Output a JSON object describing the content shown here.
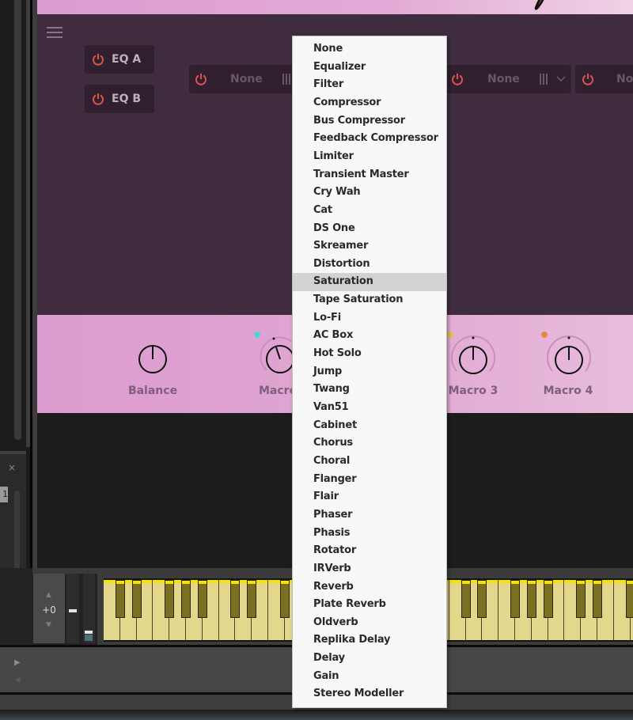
{
  "side_panel": {
    "close_symbol": "×",
    "tag_label": "1"
  },
  "plugin": {
    "menu_icon": "hamburger-icon",
    "eq_buttons": [
      {
        "label": "EQ A",
        "power_on": true
      },
      {
        "label": "EQ B",
        "power_on": true
      }
    ],
    "effect_slots": [
      {
        "label": "None",
        "power_on": true
      },
      {
        "label": "None",
        "power_on": true
      },
      {
        "label": "No",
        "power_on": true
      }
    ],
    "knobs": [
      {
        "label": "Balance",
        "value": 0.5
      },
      {
        "label": "Macro",
        "value": 0.42,
        "dot_color": "#4fd3d6"
      },
      {
        "label": "Macro 3",
        "value": 0.5,
        "dot_color": "#e0c24a"
      },
      {
        "label": "Macro 4",
        "value": 0.5,
        "dot_color": "#e08a4a"
      }
    ],
    "colors": {
      "accent_pink": "#dd9ccf",
      "fx_background": "#3f2c3f",
      "power_icon": "#d9534f"
    }
  },
  "keyboard": {
    "octave_label": "+0",
    "octave_up": "▲",
    "octave_down": "▼"
  },
  "transport": {
    "expand_right": "▶",
    "expand_left": "◀"
  },
  "fx_menu": {
    "selected_index": 13,
    "items": [
      "None",
      "Equalizer",
      "Filter",
      "Compressor",
      "Bus Compressor",
      "Feedback Compressor",
      "Limiter",
      "Transient Master",
      "Cry Wah",
      "Cat",
      "DS One",
      "Skreamer",
      "Distortion",
      "Saturation",
      "Tape Saturation",
      "Lo-Fi",
      "AC Box",
      "Hot Solo",
      "Jump",
      "Twang",
      "Van51",
      "Cabinet",
      "Chorus",
      "Choral",
      "Flanger",
      "Flair",
      "Phaser",
      "Phasis",
      "Rotator",
      "IRVerb",
      "Reverb",
      "Plate Reverb",
      "Oldverb",
      "Replika Delay",
      "Delay",
      "Gain",
      "Stereo Modeller"
    ]
  }
}
